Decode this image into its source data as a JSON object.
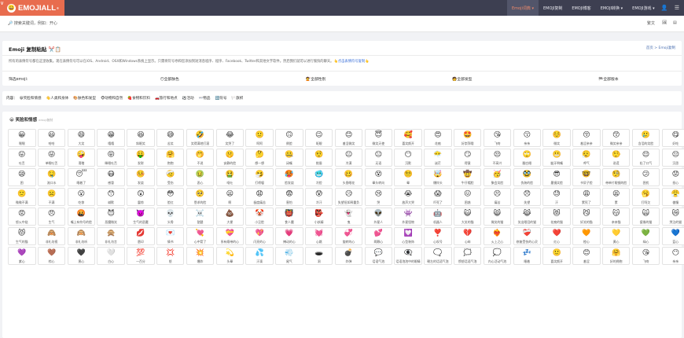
{
  "brand": {
    "name": "EMOJIALL",
    "reg": "®",
    "face": "😀"
  },
  "corner_mark": "∨",
  "nav": {
    "items": [
      {
        "label": "Emoji词典 ▾",
        "active": true
      },
      {
        "label": "EMOJI复制",
        "active": false
      },
      {
        "label": "EMOJI博客",
        "active": false
      },
      {
        "label": "EMOJI转换 ▾",
        "active": false
      },
      {
        "label": "EMOJI游戏 ▾",
        "active": false
      }
    ],
    "user_icon": "👤",
    "menu_icon": "☰"
  },
  "search": {
    "placeholder": "🔎 搜索关键词，例如：开心"
  },
  "toolbar": {
    "lang": "繁文",
    "icon2": "🖼",
    "icon3": "▤"
  },
  "page": {
    "title": "Emoji 复制粘贴 ✂️📋",
    "breadcrumb": "首页 > Emoji复制",
    "desc": "所有的表情符号都在这里收集。现在表情符号可以在iOS、Android、OSX和Windows系统上显示。只需将符号😎和您添加到短消息程序、程序、Facebook、Twitter和其他文字软件。然后我们就可以进行愉快的聊天。",
    "desc_link": "👆点击表情符号复制👆"
  },
  "filters": [
    "筛选emoji:",
    "😶全部肤色",
    "💇全部性别",
    "🧑全部发型",
    "🏁全部版本"
  ],
  "categories": {
    "lead": "内容：",
    "items": [
      "😀笑脸和情感",
      "👋人类和身体",
      "🎨肤色和发型",
      "🐵动物和自然",
      "🍓食物和饮料",
      "🚗旅行和地点",
      "⚽活动",
      "👓物品",
      "🔣符号",
      "🏳️旗帜"
    ]
  },
  "section": {
    "title": "😀 笑脸和情感",
    "sub": "emoji复制"
  },
  "emojis": [
    [
      "😀",
      "嘿嘿"
    ],
    [
      "😃",
      "哈哈"
    ],
    [
      "😄",
      "大笑"
    ],
    [
      "😁",
      "嘻嘻"
    ],
    [
      "😆",
      "斜眼笑"
    ],
    [
      "😅",
      "苦笑"
    ],
    [
      "🤣",
      "笑得满地打滚"
    ],
    [
      "😂",
      "笑哭了"
    ],
    [
      "🙂",
      "呵呵"
    ],
    [
      "🙃",
      "倒脸"
    ],
    [
      "😉",
      "眨眼"
    ],
    [
      "😊",
      "羞涩微笑"
    ],
    [
      "😇",
      "微笑天使"
    ],
    [
      "🥰",
      "喜笑颜开"
    ],
    [
      "😍",
      "花痴"
    ],
    [
      "🤩",
      "好崇拜哦"
    ],
    [
      "😘",
      "飞吻"
    ],
    [
      "😗",
      "亲亲"
    ],
    [
      "☺️",
      "微笑"
    ],
    [
      "😚",
      "羞涩亲亲"
    ],
    [
      "😙",
      "微笑亲亲"
    ],
    [
      "🥲",
      "含泪的笑脸"
    ],
    [
      "😋",
      "好吃"
    ],
    [
      "😛",
      "吐舌"
    ],
    [
      "😜",
      "单眼吐舌"
    ],
    [
      "🤪",
      "滑稽"
    ],
    [
      "😝",
      "眯眼吐舌"
    ],
    [
      "🤑",
      "发财"
    ],
    [
      "🤗",
      "抱抱"
    ],
    [
      "🤭",
      "不说"
    ],
    [
      "🤫",
      "安静的脸"
    ],
    [
      "🤔",
      "想一想"
    ],
    [
      "🤐",
      "闭嘴"
    ],
    [
      "🤨",
      "挑眉"
    ],
    [
      "😐",
      "冷漠"
    ],
    [
      "😑",
      "无语"
    ],
    [
      "😶",
      "沉默"
    ],
    [
      "😶‍🌫️",
      "迷茫"
    ],
    [
      "😏",
      "得意"
    ],
    [
      "😒",
      "不高兴"
    ],
    [
      "🙄",
      "翻白眼"
    ],
    [
      "😬",
      "龇牙咧嘴"
    ],
    [
      "😮‍💨",
      "呼气"
    ],
    [
      "🤥",
      "说谎"
    ],
    [
      "😌",
      "松了口气"
    ],
    [
      "😔",
      "沉思"
    ],
    [
      "😪",
      "困"
    ],
    [
      "🤤",
      "流口水"
    ],
    [
      "😴",
      "睡着了"
    ],
    [
      "😷",
      "感冒"
    ],
    [
      "🤒",
      "发烧"
    ],
    [
      "🤕",
      "受伤"
    ],
    [
      "🤢",
      "恶心"
    ],
    [
      "🤮",
      "呕吐"
    ],
    [
      "🤧",
      "打喷嚏"
    ],
    [
      "🥵",
      "脸发烧"
    ],
    [
      "🥶",
      "冷脸"
    ],
    [
      "🥴",
      "头昏眼花"
    ],
    [
      "😵",
      "晕头转向"
    ],
    [
      "😵‍💫",
      "晕"
    ],
    [
      "🤯",
      "爆炸头"
    ],
    [
      "🤠",
      "牛仔帽脸"
    ],
    [
      "🥳",
      "聚会笑脸"
    ],
    [
      "🥸",
      "伪装的脸"
    ],
    [
      "😎",
      "墨镜笑脸"
    ],
    [
      "🤓",
      "书呆子脸"
    ],
    [
      "🧐",
      "带单片眼镜的脸"
    ],
    [
      "😕",
      "困扰"
    ],
    [
      "😟",
      "担心"
    ],
    [
      "🙁",
      "微微不满"
    ],
    [
      "☹️",
      "不满"
    ],
    [
      "😮",
      "吃惊"
    ],
    [
      "😯",
      "缄默"
    ],
    [
      "😲",
      "震惊"
    ],
    [
      "😳",
      "脸红"
    ],
    [
      "🥺",
      "恳求的脸"
    ],
    [
      "😦",
      "啊"
    ],
    [
      "😧",
      "极度痛苦"
    ],
    [
      "😨",
      "害怕"
    ],
    [
      "😰",
      "冷汗"
    ],
    [
      "😥",
      "失望但如释重负"
    ],
    [
      "😢",
      "哭"
    ],
    [
      "😭",
      "放声大哭"
    ],
    [
      "😱",
      "吓死了"
    ],
    [
      "😖",
      "困惑"
    ],
    [
      "😣",
      "痛苦"
    ],
    [
      "😞",
      "失望"
    ],
    [
      "😓",
      "汗"
    ],
    [
      "😩",
      "累死了"
    ],
    [
      "😫",
      "累"
    ],
    [
      "🥱",
      "打呵欠"
    ],
    [
      "😤",
      "傲慢"
    ],
    [
      "😡",
      "怒火中烧"
    ],
    [
      "😠",
      "生气"
    ],
    [
      "🤬",
      "嘴上有符号的脸"
    ],
    [
      "😈",
      "恶魔微笑"
    ],
    [
      "👿",
      "生气的恶魔"
    ],
    [
      "💀",
      "头骨"
    ],
    [
      "☠️",
      "骷髅"
    ],
    [
      "💩",
      "大便"
    ],
    [
      "🤡",
      "小丑脸"
    ],
    [
      "👹",
      "食人魔"
    ],
    [
      "👺",
      "小妖精"
    ],
    [
      "👻",
      "鬼"
    ],
    [
      "👽",
      "外星人"
    ],
    [
      "👾",
      "外星怪物"
    ],
    [
      "🤖",
      "机器人"
    ],
    [
      "😺",
      "大笑的猫"
    ],
    [
      "😸",
      "微笑的猫"
    ],
    [
      "😹",
      "笑出眼泪的猫"
    ],
    [
      "😻",
      "花痴的猫"
    ],
    [
      "😼",
      "奸笑的猫"
    ],
    [
      "😽",
      "亲亲猫"
    ],
    [
      "🙀",
      "疲倦的猫"
    ],
    [
      "😿",
      "哭泣的猫"
    ],
    [
      "😾",
      "生气的猫"
    ],
    [
      "🙈",
      "非礼勿视"
    ],
    [
      "🙉",
      "非礼勿听"
    ],
    [
      "🙊",
      "非礼勿言"
    ],
    [
      "💋",
      "唇印"
    ],
    [
      "💌",
      "情书"
    ],
    [
      "💘",
      "心中箭了"
    ],
    [
      "💝",
      "系有缎带的心"
    ],
    [
      "💖",
      "闪亮的心"
    ],
    [
      "💗",
      "搏动的心"
    ],
    [
      "💓",
      "心跳"
    ],
    [
      "💞",
      "旋转的心"
    ],
    [
      "💕",
      "两颗心"
    ],
    [
      "💟",
      "心型装饰"
    ],
    [
      "❣️",
      "心叹号"
    ],
    [
      "💔",
      "心碎"
    ],
    [
      "❤️‍🔥",
      "火上之心"
    ],
    [
      "❤️‍🩹",
      "修复受伤的心灵"
    ],
    [
      "❤️",
      "红心"
    ],
    [
      "🧡",
      "橙心"
    ],
    [
      "💛",
      "黄心"
    ],
    [
      "💚",
      "绿心"
    ],
    [
      "💙",
      "蓝心"
    ],
    [
      "💜",
      "紫心"
    ],
    [
      "🤎",
      "棕心"
    ],
    [
      "🖤",
      "黑心"
    ],
    [
      "🤍",
      "白心"
    ],
    [
      "💯",
      "一百分"
    ],
    [
      "💢",
      "怒"
    ],
    [
      "💥",
      "爆炸"
    ],
    [
      "💫",
      "头晕"
    ],
    [
      "💦",
      "汗滴"
    ],
    [
      "💨",
      "尾气"
    ],
    [
      "🕳️",
      "洞"
    ],
    [
      "💣",
      "炸弹"
    ],
    [
      "💬",
      "话语气泡"
    ],
    [
      "👁️‍🗨️",
      "话语泡泡中的眼睛"
    ],
    [
      "🗨️",
      "朝左的话语气泡"
    ],
    [
      "🗯️",
      "愤怒话语气泡"
    ],
    [
      "💭",
      "内心活动气泡"
    ],
    [
      "💤",
      "睡着"
    ],
    [
      "🙂",
      "喜笑颜开"
    ],
    [
      "😊",
      "羞涩"
    ],
    [
      "🤗",
      "好的拥抱"
    ],
    [
      "😘",
      "飞吻"
    ],
    [
      "😶",
      "亲亲"
    ]
  ]
}
